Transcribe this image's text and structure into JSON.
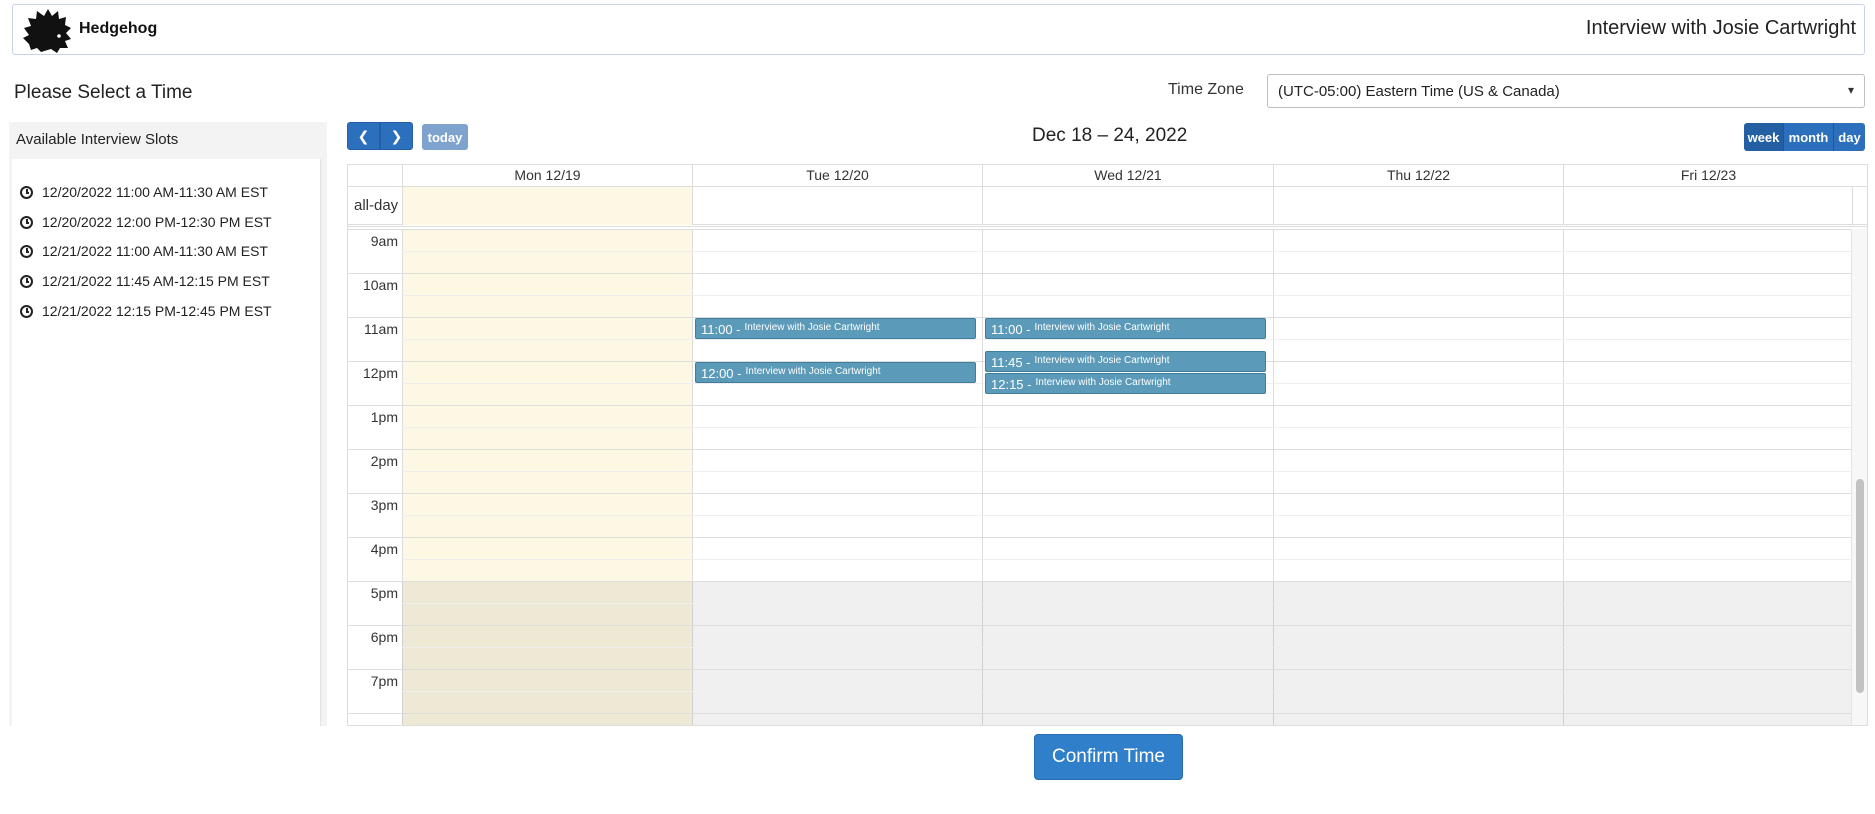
{
  "header": {
    "brand": "Hedgehog",
    "title": "Interview with Josie Cartwright"
  },
  "page": {
    "heading": "Please Select a Time",
    "timezone_label": "Time Zone",
    "timezone_value": "(UTC-05:00) Eastern Time (US & Canada)"
  },
  "slots": {
    "header": "Available Interview Slots",
    "items": [
      "12/20/2022 11:00 AM-11:30 AM EST",
      "12/20/2022 12:00 PM-12:30 PM EST",
      "12/21/2022 11:00 AM-11:30 AM EST",
      "12/21/2022 11:45 AM-12:15 PM EST",
      "12/21/2022 12:15 PM-12:45 PM EST"
    ]
  },
  "toolbar": {
    "prev_icon": "chevron-left-icon",
    "next_icon": "chevron-right-icon",
    "prev_glyph": "❮",
    "next_glyph": "❯",
    "today": "today",
    "range": "Dec 18 – 24, 2022",
    "views": [
      "week",
      "month",
      "day"
    ]
  },
  "calendar": {
    "allday_label": "all-day",
    "columns": [
      "Mon 12/19",
      "Tue 12/20",
      "Wed 12/21",
      "Thu 12/22",
      "Fri 12/23"
    ],
    "hours": [
      "9am",
      "10am",
      "11am",
      "12pm",
      "1pm",
      "2pm",
      "3pm",
      "4pm",
      "5pm",
      "6pm",
      "7pm"
    ],
    "events": [
      {
        "time": "11:00 -",
        "title": "Interview with Josie Cartwright"
      },
      {
        "time": "12:00 -",
        "title": "Interview with Josie Cartwright"
      },
      {
        "time": "11:00 -",
        "title": "Interview with Josie Cartwright"
      },
      {
        "time": "11:45 -",
        "title": "Interview with Josie Cartwright"
      },
      {
        "time": "12:15 -",
        "title": "Interview with Josie Cartwright"
      }
    ]
  },
  "footer": {
    "confirm": "Confirm Time"
  },
  "colors": {
    "primary": "#2c6fbd",
    "event": "#5b9ab8",
    "today_highlight": "#fcf8e3"
  }
}
